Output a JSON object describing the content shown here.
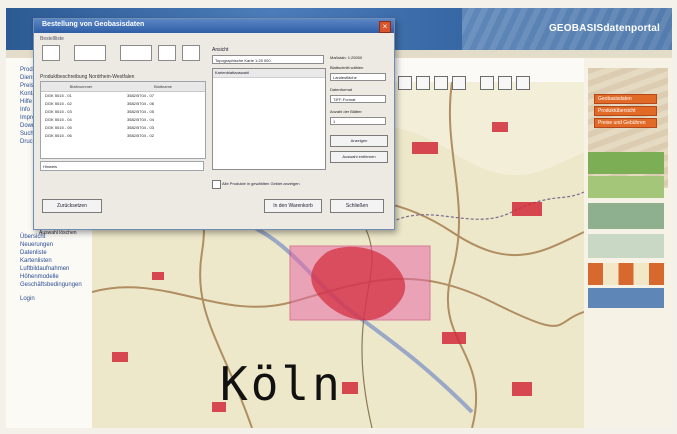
{
  "brand": "GEOBASISdatenportal",
  "left_nav": {
    "items": [
      "Produkte",
      "Dienste",
      "Preise",
      "Kontakt",
      "Hilfe",
      "Info",
      "Impressum",
      "Download",
      "Suche",
      "Druck"
    ],
    "lower_items": [
      "Übersicht",
      "Neuerungen",
      "Datenliste",
      "Kartenlisten",
      "Luftbildaufnahmen",
      "Höhenmodelle",
      "Geschäftsbedingungen",
      "Login"
    ]
  },
  "dialog": {
    "title": "Bestellung von Geobasisdaten",
    "subtitle": "Bestellliste",
    "product_label": "Produktbeschreibung   Nordrhein-Westfalen",
    "table": {
      "headers": [
        "Blattnummer",
        "Blattname"
      ],
      "rows": [
        [
          "DGK 5015 - 01",
          "3582/5704 - 07"
        ],
        [
          "DGK 5015 - 02",
          "3582/5704 - 06"
        ],
        [
          "DGK 5015 - 03",
          "3582/5704 - 05"
        ],
        [
          "DGK 5015 - 04",
          "3582/5704 - 04"
        ],
        [
          "DGK 5015 - 05",
          "3582/5704 - 03"
        ],
        [
          "DGK 5015 - 06",
          "3582/5704 - 02"
        ]
      ]
    },
    "note_value": "Hinweis",
    "btn_zurueck": "Zurücksetzen",
    "ansicht_label": "Ansicht",
    "ansicht_value": "Topographische Karte 1:25 000",
    "list_header": "Kartenblattauswahl",
    "check_label": "Alle Produkte in gewählten Gebiet anzeigen",
    "btn_warenkorb": "In den Warenkorb",
    "btn_schliessen": "Schließen",
    "right_fields": {
      "massstab": "Maßstab: 1:25000",
      "blattschnitt": "Blattschnitt wählen",
      "blattschnitt_value": "Landesfläche",
      "datenformat": "Datenformat",
      "datenformat_value": "TIFF-Format",
      "anzahl": "Anzahl der Blätter",
      "anzahl_value": "1",
      "btn_anzeigen": "Anzeigen",
      "btn_entfernen": "Auswahl entfernen"
    },
    "auswahl": "Auswahl löschen"
  },
  "map": {
    "city_label": "Köln"
  },
  "right_panel": {
    "buttons": [
      "Geobasisdaten",
      "Produktübersicht",
      "Preise und Gebühren"
    ]
  },
  "colors": {
    "header": "#2c5a93",
    "accent": "#e26a27",
    "map_red": "#d22a3a",
    "map_selection": "#e66aa6"
  }
}
